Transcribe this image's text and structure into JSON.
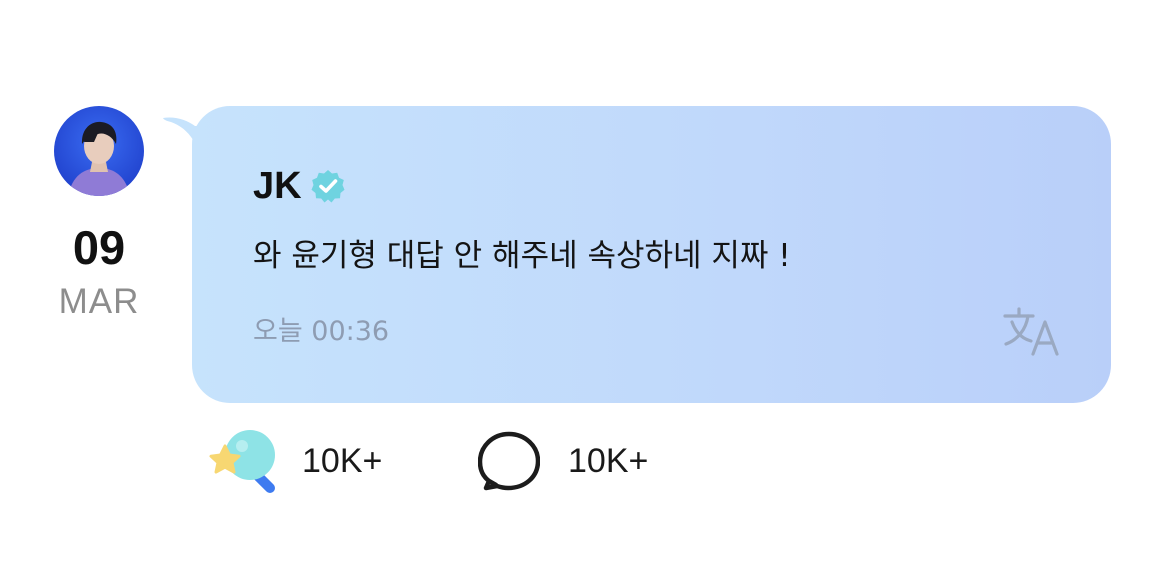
{
  "post": {
    "date_day": "09",
    "date_month": "MAR",
    "author": "JK",
    "message": "와 윤기형 대답 안 해주네 속상하네 지짜 !",
    "timestamp": "오늘 00:36"
  },
  "reactions": {
    "likes": "10K+",
    "comments": "10K+"
  },
  "colors": {
    "bubble_start": "#c6e3fc",
    "bubble_end": "#b9cff9",
    "verified": "#6fd3e0",
    "timestamp": "#8e9cb2"
  },
  "icons": {
    "avatar": "avatar",
    "verified": "verified-badge-icon",
    "translate": "translate-icon",
    "like": "star-lightstick-icon",
    "comment": "speech-bubble-icon"
  }
}
